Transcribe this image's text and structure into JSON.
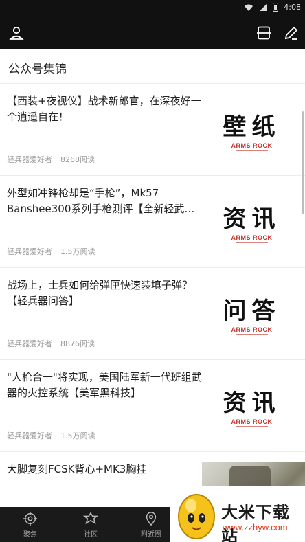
{
  "status_bar": {
    "time": "4:08"
  },
  "section": {
    "title": "公众号集锦"
  },
  "articles": [
    {
      "title": "【西装+夜视仪】战术新郎官，在深夜好一个逍遥自在！",
      "source": "轻兵器爱好者",
      "reads": "8268阅读",
      "thumb_word": "壁纸",
      "thumb_brand": "ARMS ROCK"
    },
    {
      "title": "外型如冲锋枪却是“手枪”，Mk57 Banshee300系列手枪测评【全新轻武…",
      "source": "轻兵器爱好者",
      "reads": "1.5万阅读",
      "thumb_word": "资讯",
      "thumb_brand": "ARMS ROCK"
    },
    {
      "title": "战场上，士兵如何给弹匣快速装填子弹？【轻兵器问答】",
      "source": "轻兵器爱好者",
      "reads": "8876阅读",
      "thumb_word": "问答",
      "thumb_brand": "ARMS ROCK"
    },
    {
      "title": "\"人枪合一\"将实现，美国陆军新一代班组武器的火控系统【美军黑科技】",
      "source": "轻兵器爱好者",
      "reads": "1.5万阅读",
      "thumb_word": "资讯",
      "thumb_brand": "ARMS ROCK"
    },
    {
      "title": "大脚复刻FCSK背心+MK3胸挂"
    }
  ],
  "bottom_nav": [
    {
      "label": "聚焦",
      "icon": "crosshair-icon"
    },
    {
      "label": "社区",
      "icon": "star-badge-icon"
    },
    {
      "label": "附近圈",
      "icon": "location-pin-icon"
    }
  ],
  "watermark": {
    "title": "大米下载站",
    "url": "www.zzhyw.com"
  },
  "colors": {
    "topbar": "#111111",
    "brand_red": "#c0302a",
    "watermark_url": "#e23a1a"
  }
}
